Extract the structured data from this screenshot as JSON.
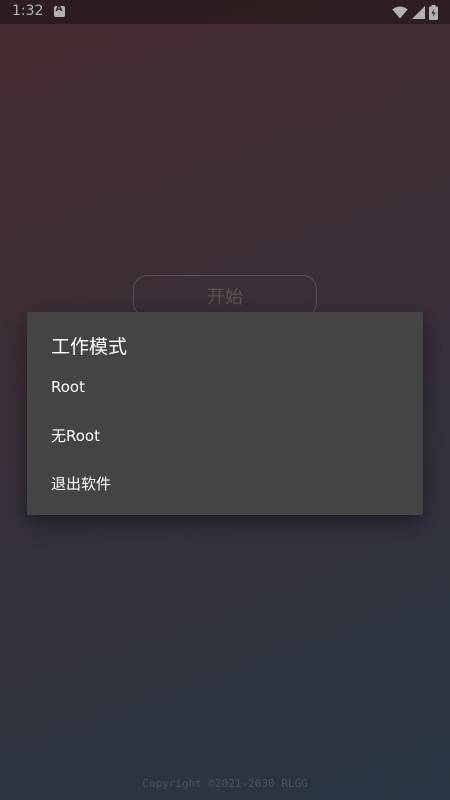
{
  "status_bar": {
    "time": "1:32",
    "icons": [
      "notification-a-icon",
      "wifi-icon",
      "cell-signal-icon",
      "battery-icon"
    ]
  },
  "main": {
    "start_button_label": "开始",
    "copyright": "Copyright ©2021-2030 RLGG"
  },
  "dialog": {
    "title": "工作模式",
    "items": [
      {
        "label": "Root"
      },
      {
        "label": "无Root"
      },
      {
        "label": "退出软件"
      }
    ]
  },
  "colors": {
    "dialog_background": "#444444",
    "gradient_top": "#663e45",
    "gradient_bottom": "#3a4e60"
  }
}
